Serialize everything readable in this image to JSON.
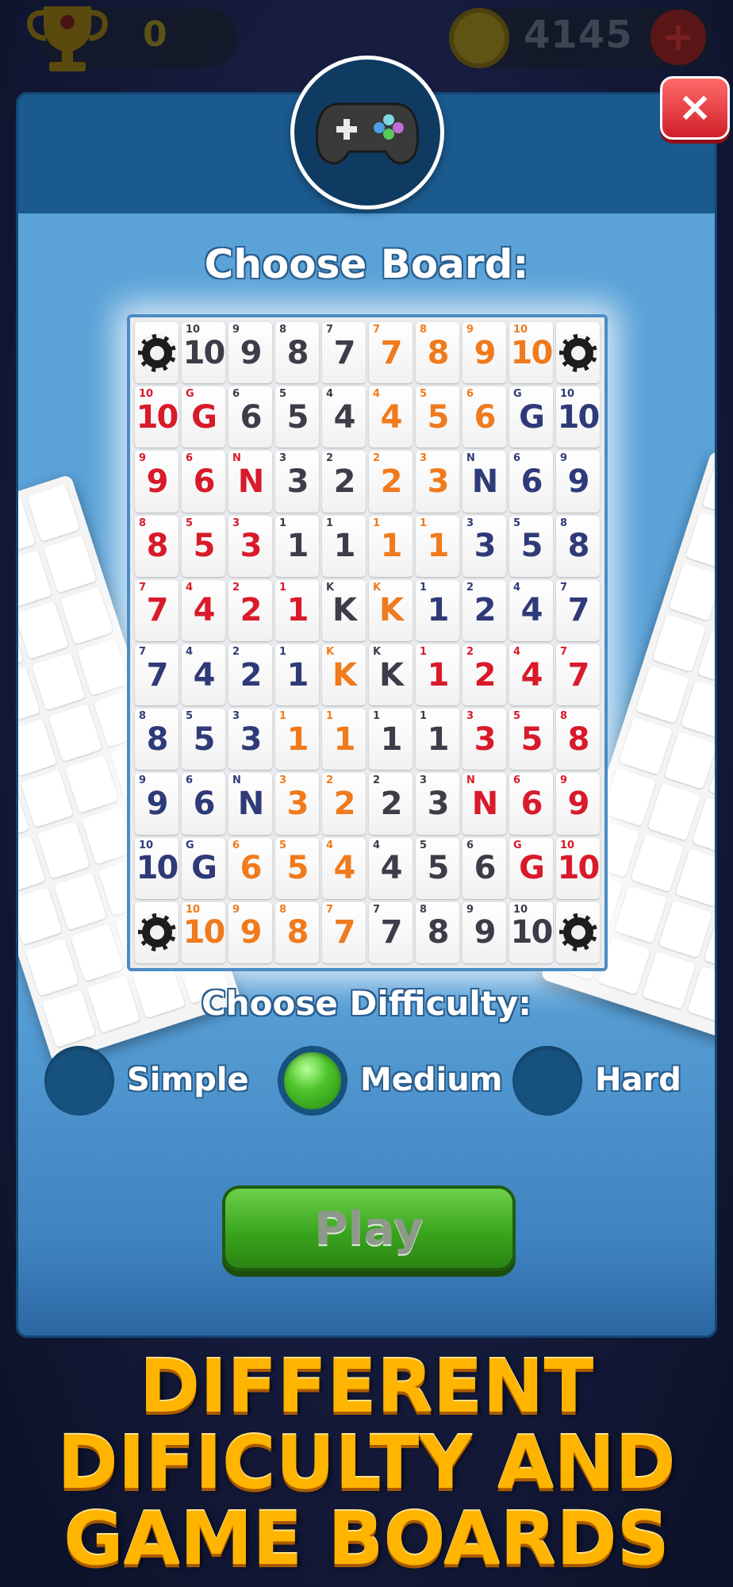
{
  "hud": {
    "trophy_value": "0",
    "coin_value": "4145",
    "add_label": "+"
  },
  "dialog": {
    "close_label": "×",
    "choose_board_label": "Choose Board:",
    "choose_difficulty_label": "Choose Difficulty:",
    "difficulties": [
      {
        "label": "Simple",
        "selected": false
      },
      {
        "label": "Medium",
        "selected": true
      },
      {
        "label": "Hard",
        "selected": false
      }
    ],
    "play_label": "Play"
  },
  "board": {
    "rows": [
      [
        {
          "chip": true
        },
        {
          "v": "10",
          "c": "d"
        },
        {
          "v": "9",
          "c": "d"
        },
        {
          "v": "8",
          "c": "d"
        },
        {
          "v": "7",
          "c": "d"
        },
        {
          "v": "7",
          "c": "o"
        },
        {
          "v": "8",
          "c": "o"
        },
        {
          "v": "9",
          "c": "o"
        },
        {
          "v": "10",
          "c": "o"
        },
        {
          "chip": true
        }
      ],
      [
        {
          "v": "10",
          "c": "r"
        },
        {
          "v": "G",
          "c": "r"
        },
        {
          "v": "6",
          "c": "d"
        },
        {
          "v": "5",
          "c": "d"
        },
        {
          "v": "4",
          "c": "d"
        },
        {
          "v": "4",
          "c": "o"
        },
        {
          "v": "5",
          "c": "o"
        },
        {
          "v": "6",
          "c": "o"
        },
        {
          "v": "G",
          "c": "b"
        },
        {
          "v": "10",
          "c": "b"
        }
      ],
      [
        {
          "v": "9",
          "c": "r"
        },
        {
          "v": "6",
          "c": "r"
        },
        {
          "v": "N",
          "c": "r"
        },
        {
          "v": "3",
          "c": "d"
        },
        {
          "v": "2",
          "c": "d"
        },
        {
          "v": "2",
          "c": "o"
        },
        {
          "v": "3",
          "c": "o"
        },
        {
          "v": "N",
          "c": "b"
        },
        {
          "v": "6",
          "c": "b"
        },
        {
          "v": "9",
          "c": "b"
        }
      ],
      [
        {
          "v": "8",
          "c": "r"
        },
        {
          "v": "5",
          "c": "r"
        },
        {
          "v": "3",
          "c": "r"
        },
        {
          "v": "1",
          "c": "d"
        },
        {
          "v": "1",
          "c": "d"
        },
        {
          "v": "1",
          "c": "o"
        },
        {
          "v": "1",
          "c": "o"
        },
        {
          "v": "3",
          "c": "b"
        },
        {
          "v": "5",
          "c": "b"
        },
        {
          "v": "8",
          "c": "b"
        }
      ],
      [
        {
          "v": "7",
          "c": "r"
        },
        {
          "v": "4",
          "c": "r"
        },
        {
          "v": "2",
          "c": "r"
        },
        {
          "v": "1",
          "c": "r"
        },
        {
          "v": "K",
          "c": "d"
        },
        {
          "v": "K",
          "c": "o"
        },
        {
          "v": "1",
          "c": "b"
        },
        {
          "v": "2",
          "c": "b"
        },
        {
          "v": "4",
          "c": "b"
        },
        {
          "v": "7",
          "c": "b"
        }
      ],
      [
        {
          "v": "7",
          "c": "b"
        },
        {
          "v": "4",
          "c": "b"
        },
        {
          "v": "2",
          "c": "b"
        },
        {
          "v": "1",
          "c": "b"
        },
        {
          "v": "K",
          "c": "o"
        },
        {
          "v": "K",
          "c": "d"
        },
        {
          "v": "1",
          "c": "r"
        },
        {
          "v": "2",
          "c": "r"
        },
        {
          "v": "4",
          "c": "r"
        },
        {
          "v": "7",
          "c": "r"
        }
      ],
      [
        {
          "v": "8",
          "c": "b"
        },
        {
          "v": "5",
          "c": "b"
        },
        {
          "v": "3",
          "c": "b"
        },
        {
          "v": "1",
          "c": "o"
        },
        {
          "v": "1",
          "c": "o"
        },
        {
          "v": "1",
          "c": "d"
        },
        {
          "v": "1",
          "c": "d"
        },
        {
          "v": "3",
          "c": "r"
        },
        {
          "v": "5",
          "c": "r"
        },
        {
          "v": "8",
          "c": "r"
        }
      ],
      [
        {
          "v": "9",
          "c": "b"
        },
        {
          "v": "6",
          "c": "b"
        },
        {
          "v": "N",
          "c": "b"
        },
        {
          "v": "3",
          "c": "o"
        },
        {
          "v": "2",
          "c": "o"
        },
        {
          "v": "2",
          "c": "d"
        },
        {
          "v": "3",
          "c": "d"
        },
        {
          "v": "N",
          "c": "r"
        },
        {
          "v": "6",
          "c": "r"
        },
        {
          "v": "9",
          "c": "r"
        }
      ],
      [
        {
          "v": "10",
          "c": "b"
        },
        {
          "v": "G",
          "c": "b"
        },
        {
          "v": "6",
          "c": "o"
        },
        {
          "v": "5",
          "c": "o"
        },
        {
          "v": "4",
          "c": "o"
        },
        {
          "v": "4",
          "c": "d"
        },
        {
          "v": "5",
          "c": "d"
        },
        {
          "v": "6",
          "c": "d"
        },
        {
          "v": "G",
          "c": "r"
        },
        {
          "v": "10",
          "c": "r"
        }
      ],
      [
        {
          "chip": true
        },
        {
          "v": "10",
          "c": "o"
        },
        {
          "v": "9",
          "c": "o"
        },
        {
          "v": "8",
          "c": "o"
        },
        {
          "v": "7",
          "c": "o"
        },
        {
          "v": "7",
          "c": "d"
        },
        {
          "v": "8",
          "c": "d"
        },
        {
          "v": "9",
          "c": "d"
        },
        {
          "v": "10",
          "c": "d"
        },
        {
          "chip": true
        }
      ]
    ],
    "colors": {
      "d": "#3d3d4a",
      "o": "#f07a1c",
      "r": "#d81a2a",
      "b": "#2f3a78"
    }
  },
  "tagline": [
    "DIFFERENT",
    "DIFICULTY AND",
    "GAME BOARDS"
  ]
}
